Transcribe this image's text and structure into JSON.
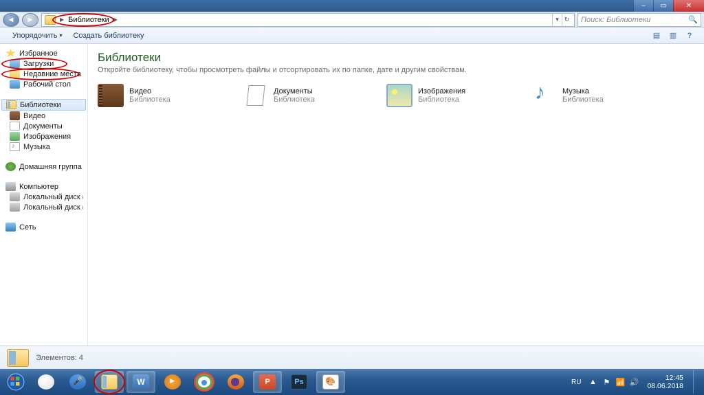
{
  "window_controls": {
    "min": "–",
    "max": "▭",
    "close": "✕"
  },
  "address_bar": {
    "path": "Библиотеки",
    "refresh": "↻",
    "dropdown": "▾"
  },
  "search": {
    "placeholder": "Поиск: Библиотеки",
    "icon": "🔍"
  },
  "toolbar": {
    "organize": "Упорядочить",
    "new_library": "Создать библиотеку",
    "dd": "▾",
    "view_icon": "▤",
    "preview_icon": "▥",
    "help_icon": "?"
  },
  "sidebar": {
    "favorites": {
      "head": "Избранное",
      "items": [
        "Загрузки",
        "Недавние места",
        "Рабочий стол"
      ]
    },
    "libraries": {
      "head": "Библиотеки",
      "items": [
        "Видео",
        "Документы",
        "Изображения",
        "Музыка"
      ]
    },
    "homegroup": {
      "head": "Домашняя группа"
    },
    "computer": {
      "head": "Компьютер",
      "items": [
        "Локальный диск (C:)",
        "Локальный диск (D:)"
      ]
    },
    "network": {
      "head": "Сеть"
    }
  },
  "content": {
    "title": "Библиотеки",
    "subtitle": "Откройте библиотеку, чтобы просмотреть файлы и отсортировать их по папке, дате и другим свойствам.",
    "items": [
      {
        "name": "Видео",
        "sub": "Библиотека"
      },
      {
        "name": "Документы",
        "sub": "Библиотека"
      },
      {
        "name": "Изображения",
        "sub": "Библиотека"
      },
      {
        "name": "Музыка",
        "sub": "Библиотека"
      }
    ]
  },
  "status": {
    "text": "Элементов: 4"
  },
  "tray": {
    "lang": "RU",
    "up": "▲",
    "flag": "⚑",
    "net": "📶",
    "vol": "🔊",
    "time": "12:45",
    "date": "08.06.2018"
  }
}
